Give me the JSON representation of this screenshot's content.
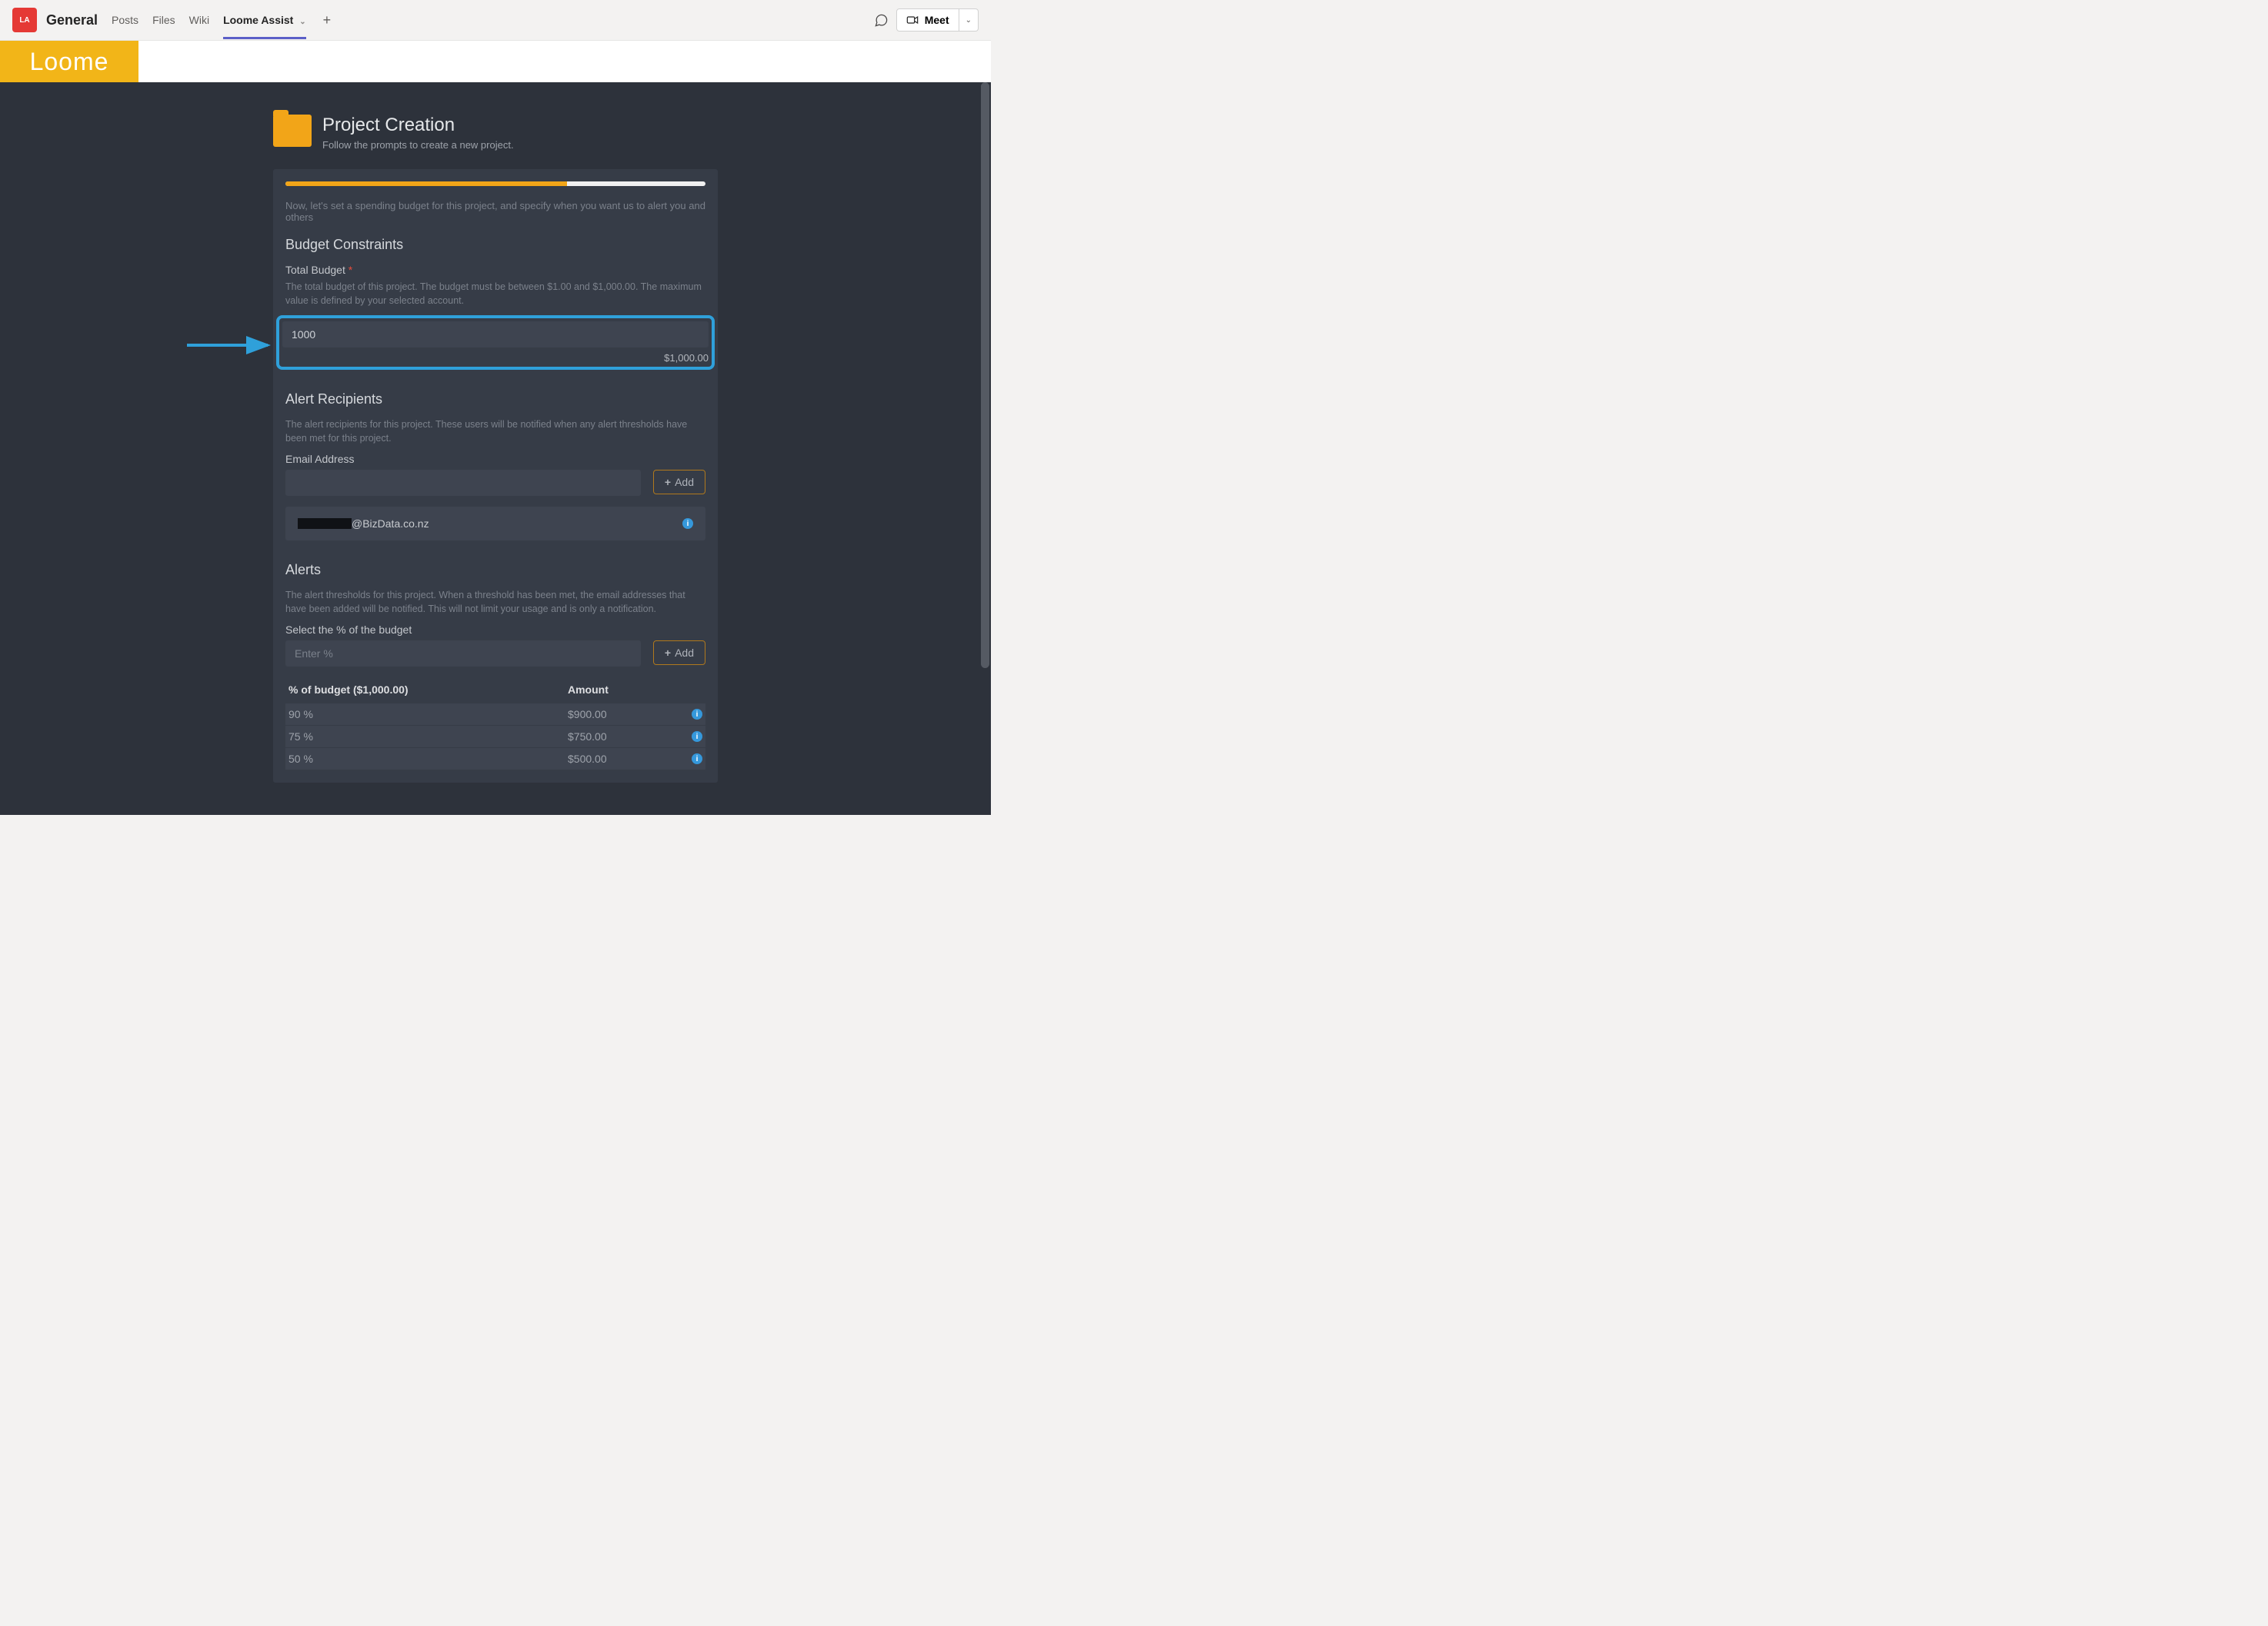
{
  "teams": {
    "team_icon_label": "LA",
    "channel_name": "General",
    "tabs": [
      "Posts",
      "Files",
      "Wiki",
      "Loome Assist"
    ],
    "active_tab_index": 3,
    "meet_label": "Meet"
  },
  "banner": {
    "logo_text": "Loome"
  },
  "page": {
    "title": "Project Creation",
    "subtitle": "Follow the prompts to create a new project.",
    "intro": "Now, let's set a spending budget for this project, and specify when you want us to alert you and others"
  },
  "budget": {
    "section_title": "Budget Constraints",
    "label": "Total Budget",
    "help": "The total budget of this project. The budget must be between $1.00 and $1,000.00. The maximum value is defined by your selected account.",
    "value": "1000",
    "formatted": "$1,000.00"
  },
  "recipients": {
    "section_title": "Alert Recipients",
    "help": "The alert recipients for this project. These users will be notified when any alert thresholds have been met for this project.",
    "email_label": "Email Address",
    "add_label": "Add",
    "chip_domain": "@BizData.co.nz"
  },
  "alerts": {
    "section_title": "Alerts",
    "help": "The alert thresholds for this project. When a threshold has been met, the email addresses that have been added will be notified. This will not limit your usage and is only a notification.",
    "select_label": "Select the % of the budget",
    "placeholder": "Enter %",
    "add_label": "Add",
    "header_percent": "% of budget ($1,000.00)",
    "header_amount": "Amount",
    "rows": [
      {
        "percent": "90 %",
        "amount": "$900.00"
      },
      {
        "percent": "75 %",
        "amount": "$750.00"
      },
      {
        "percent": "50 %",
        "amount": "$500.00"
      }
    ]
  }
}
